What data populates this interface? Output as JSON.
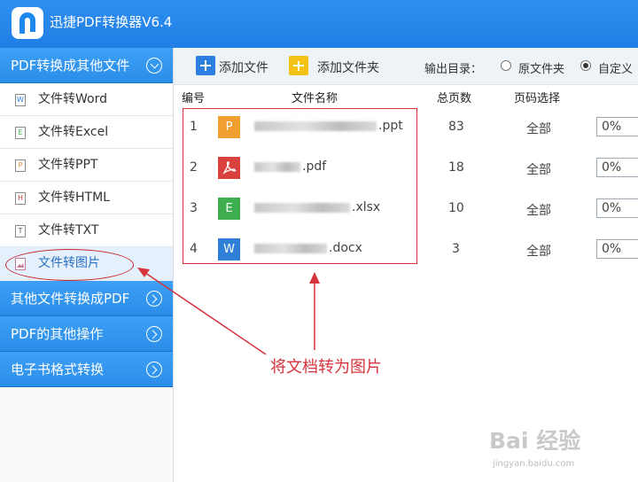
{
  "app": {
    "title": "迅捷PDF转换器V6.4"
  },
  "sidebar": {
    "group_main": "PDF转换成其他文件",
    "items": [
      {
        "label": "文件转Word",
        "icon": "W"
      },
      {
        "label": "文件转Excel",
        "icon": "E"
      },
      {
        "label": "文件转PPT",
        "icon": "P"
      },
      {
        "label": "文件转HTML",
        "icon": "H"
      },
      {
        "label": "文件转TXT",
        "icon": "T"
      },
      {
        "label": "文件转图片",
        "icon": "image"
      }
    ],
    "groups": [
      "其他文件转换成PDF",
      "PDF的其他操作",
      "电子书格式转换"
    ]
  },
  "toolbar": {
    "add_file": "添加文件",
    "add_folder": "添加文件夹",
    "output_label": "输出目录：",
    "radio_original": "原文件夹",
    "radio_custom": "自定义"
  },
  "table": {
    "headers": {
      "num": "编号",
      "name": "文件名称",
      "pages": "总页数",
      "select": "页码选择"
    },
    "rows": [
      {
        "num": "1",
        "type": "P",
        "color": "#f0a030",
        "ext": ".ppt",
        "pages": "83",
        "select": "全部",
        "progress": "0%"
      },
      {
        "num": "2",
        "type": "pdf",
        "color": "#d9413f",
        "ext": ".pdf",
        "pages": "18",
        "select": "全部",
        "progress": "0%"
      },
      {
        "num": "3",
        "type": "E",
        "color": "#3fae4f",
        "ext": ".xlsx",
        "pages": "10",
        "select": "全部",
        "progress": "0%"
      },
      {
        "num": "4",
        "type": "W",
        "color": "#2f7fd6",
        "ext": ".docx",
        "pages": "3",
        "select": "全部",
        "progress": "0%"
      }
    ]
  },
  "annotation": {
    "text": "将文档转为图片",
    "color": "#d6333b"
  },
  "watermark": {
    "main": "Bai 经验",
    "sub": "jingyan.baidu.com"
  }
}
